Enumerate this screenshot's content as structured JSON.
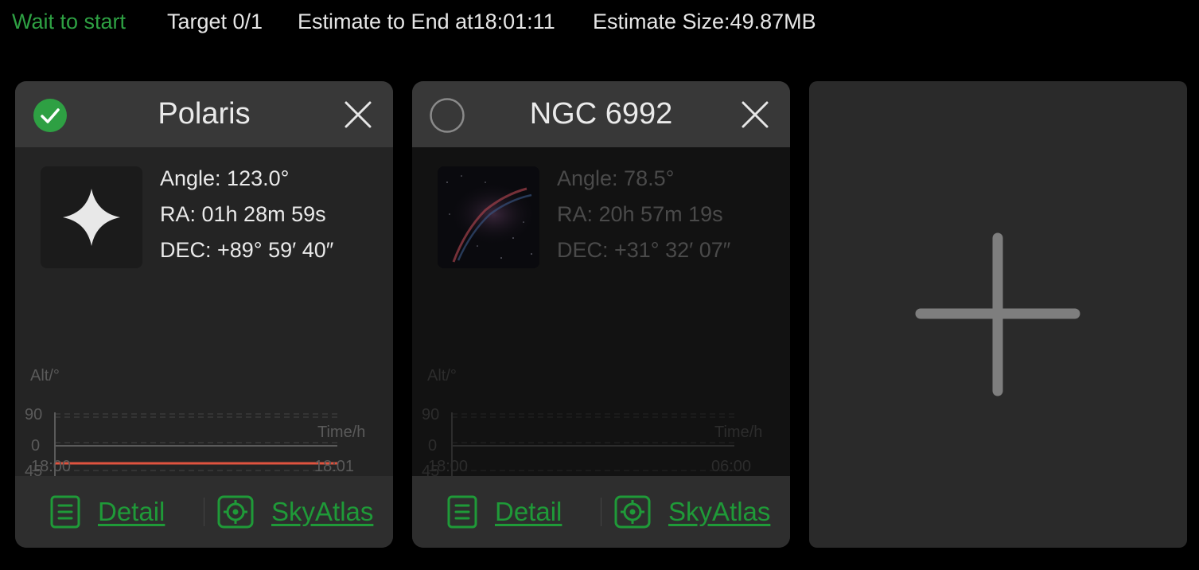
{
  "status": {
    "state": "Wait to start",
    "target": "Target  0/1",
    "estimate_end": "Estimate to End at18:01:11",
    "estimate_size": "Estimate Size:49.87MB"
  },
  "colors": {
    "accent_green": "#1f9a38",
    "altitude_line": "#e0533f",
    "background": "#000000"
  },
  "cards": [
    {
      "title": "Polaris",
      "selected": true,
      "select_icon": "check-circle-icon",
      "close_icon": "close-icon",
      "thumbnail": "star-icon",
      "angle": "Angle: 123.0°",
      "ra": "RA: 01h 28m 59s",
      "dec": "DEC: +89° 59′ 40″",
      "chart": {
        "y_label": "Alt/°",
        "y_ticks": [
          "90",
          "45",
          "0"
        ],
        "x_label": "Time/h",
        "x_ticks": [
          "18:00",
          "18:01"
        ]
      },
      "detail_label": "Detail",
      "detail_icon": "document-list-icon",
      "skyatlas_label": "SkyAtlas",
      "skyatlas_icon": "target-crosshair-icon"
    },
    {
      "title": "NGC 6992",
      "selected": false,
      "select_icon": "empty-circle-icon",
      "close_icon": "close-icon",
      "thumbnail": "nebula-image",
      "angle": "Angle: 78.5°",
      "ra": "RA: 20h 57m 19s",
      "dec": "DEC: +31° 32′ 07″",
      "chart": {
        "y_label": "Alt/°",
        "y_ticks": [
          "90",
          "45",
          "0"
        ],
        "x_label": "Time/h",
        "x_ticks": [
          "18:00",
          "06:00"
        ]
      },
      "detail_label": "Detail",
      "detail_icon": "document-list-icon",
      "skyatlas_label": "SkyAtlas",
      "skyatlas_icon": "target-crosshair-icon"
    }
  ],
  "chart_data": [
    {
      "type": "line",
      "y_label": "Alt/°",
      "x_label": "Time/h",
      "x_ticks": [
        "18:00",
        "18:01"
      ],
      "y_ticks": [
        90,
        45,
        0
      ],
      "ylim": [
        0,
        90
      ],
      "grid": true,
      "series": [
        {
          "x": [
            "18:00",
            "18:01"
          ],
          "values": [
            50,
            50
          ]
        }
      ]
    },
    {
      "type": "line",
      "y_label": "Alt/°",
      "x_label": "Time/h",
      "x_ticks": [
        "18:00",
        "06:00"
      ],
      "y_ticks": [
        90,
        45,
        0
      ],
      "ylim": [
        0,
        90
      ],
      "grid": true,
      "series": []
    }
  ],
  "add_card": {
    "icon": "plus-icon"
  }
}
